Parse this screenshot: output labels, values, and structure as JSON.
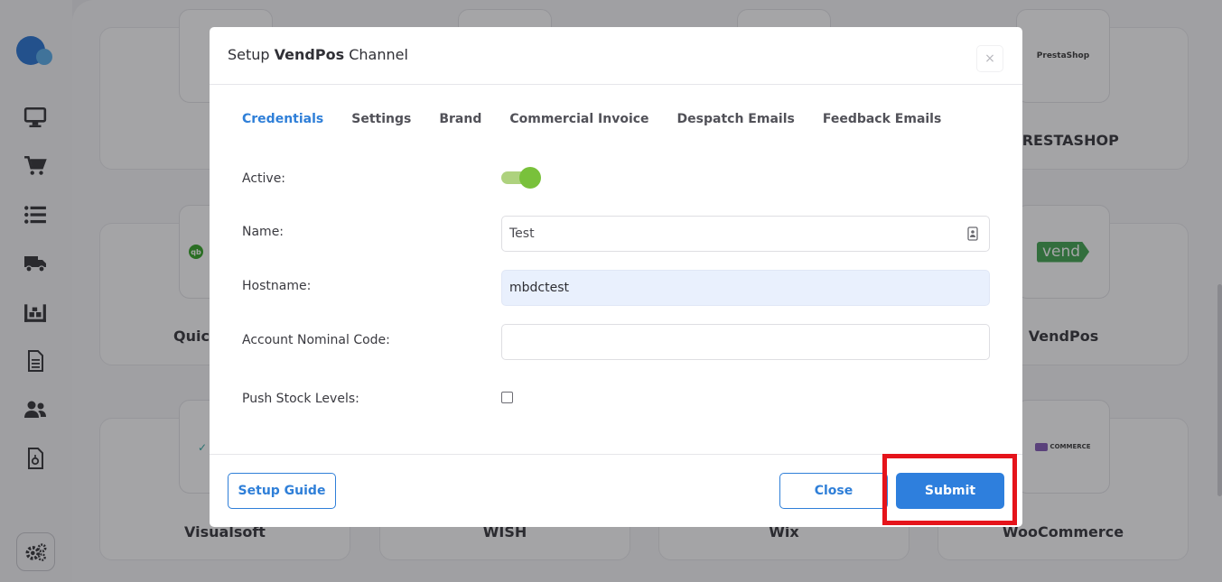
{
  "modal": {
    "title_prefix": "Setup ",
    "title_bold": "VendPos",
    "title_suffix": " Channel",
    "close_glyph": "×",
    "tabs": [
      {
        "label": "Credentials",
        "active": true
      },
      {
        "label": "Settings",
        "active": false
      },
      {
        "label": "Brand",
        "active": false
      },
      {
        "label": "Commercial Invoice",
        "active": false
      },
      {
        "label": "Despatch Emails",
        "active": false
      },
      {
        "label": "Feedback Emails",
        "active": false
      }
    ],
    "form": {
      "active_label": "Active:",
      "active_value": true,
      "name_label": "Name:",
      "name_value": "Test",
      "hostname_label": "Hostname:",
      "hostname_value": "mbdctest",
      "nominal_label": "Account Nominal Code:",
      "nominal_value": "",
      "push_stock_label": "Push Stock Levels:",
      "push_stock_checked": false
    },
    "footer": {
      "setup_guide_label": "Setup Guide",
      "close_label": "Close",
      "submit_label": "Submit"
    }
  },
  "background": {
    "cards": [
      {
        "label": "PRESTASHOP",
        "logo_text": "PrestaShop"
      },
      {
        "label": "Quic",
        "logo_text": "qb"
      },
      {
        "label": "VendPos",
        "logo_text": "vend"
      },
      {
        "label": "Visualsoft",
        "logo_text": ""
      },
      {
        "label": "WISH",
        "logo_text": ""
      },
      {
        "label": "Wix",
        "logo_text": ""
      },
      {
        "label": "WooCommerce",
        "logo_text": "COMMERCE"
      }
    ]
  },
  "sidebar": {
    "icons": [
      "monitor-icon",
      "cart-icon",
      "list-icon",
      "truck-icon",
      "warehouse-icon",
      "document-icon",
      "users-icon",
      "invoice-icon",
      "settings-gear-icon"
    ]
  },
  "colors": {
    "accent": "#2f7fd8",
    "toggle_on": "#79c13b",
    "highlight": "#e5141b"
  }
}
